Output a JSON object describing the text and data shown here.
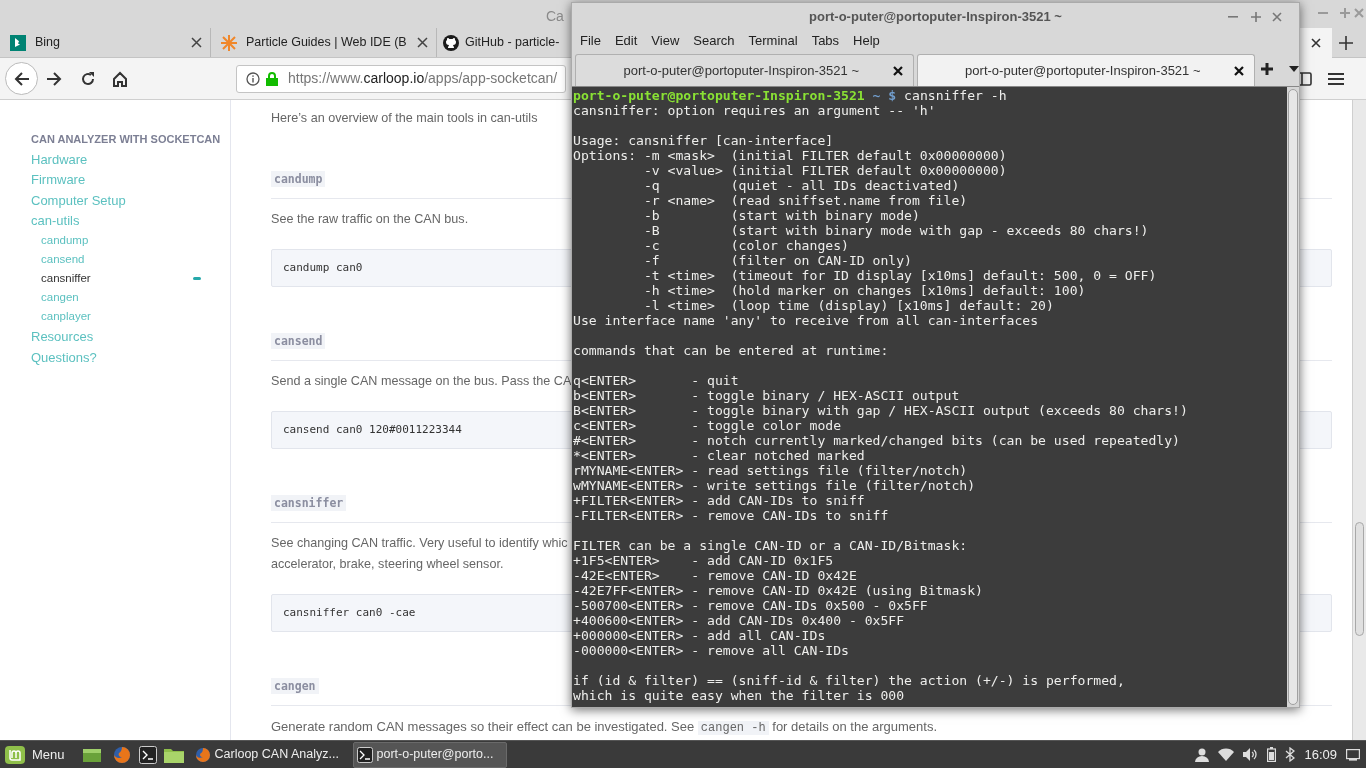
{
  "browser": {
    "title": "Ca",
    "tabs": [
      {
        "title": "Bing",
        "selected": false
      },
      {
        "title": "Particle Guides | Web IDE (B",
        "selected": false
      },
      {
        "title": "GitHub - particle-",
        "selected": false
      }
    ],
    "url": {
      "prefix": "https://www.",
      "domain": "carloop.io",
      "path": "/apps/app-socketcan/"
    },
    "sidebar": {
      "heading": "CAN ANALYZER WITH SOCKETCAN",
      "items": [
        {
          "label": "Hardware",
          "selected": false
        },
        {
          "label": "Firmware",
          "selected": false
        },
        {
          "label": "Computer Setup",
          "selected": false
        },
        {
          "label": "can-utils",
          "selected": false,
          "children": [
            {
              "label": "candump",
              "selected": false
            },
            {
              "label": "cansend",
              "selected": false
            },
            {
              "label": "cansniffer",
              "selected": true
            },
            {
              "label": "cangen",
              "selected": false
            },
            {
              "label": "canplayer",
              "selected": false
            }
          ]
        },
        {
          "label": "Resources",
          "selected": false
        },
        {
          "label": "Questions?",
          "selected": false
        }
      ]
    },
    "content": [
      {
        "kind": "paragraph",
        "lines": [
          "Here’s an overview of the main tools in can-utils"
        ]
      },
      {
        "kind": "heading",
        "text": "candump"
      },
      {
        "kind": "paragraph",
        "lines": [
          "See the raw traffic on the CAN bus."
        ]
      },
      {
        "kind": "code",
        "text": "candump can0"
      },
      {
        "kind": "heading",
        "text": "cansend"
      },
      {
        "kind": "paragraph",
        "lines": [
          "Send a single CAN message on the bus. Pass the CA"
        ]
      },
      {
        "kind": "code",
        "text": "cansend can0 120#0011223344"
      },
      {
        "kind": "heading",
        "text": "cansniffer"
      },
      {
        "kind": "paragraph",
        "lines": [
          "See changing CAN traffic. Very useful to identify whic",
          "accelerator, brake, steering wheel sensor."
        ]
      },
      {
        "kind": "code",
        "text": "cansniffer can0 -cae"
      },
      {
        "kind": "heading",
        "text": "cangen"
      },
      {
        "kind": "mixed",
        "before": "Generate random CAN messages so their effect can be investigated. See ",
        "code": "cangen -h",
        "after": " for details on the arguments."
      }
    ]
  },
  "terminal": {
    "title": "port-o-puter@portoputer-Inspiron-3521 ~",
    "menu": [
      "File",
      "Edit",
      "View",
      "Search",
      "Terminal",
      "Tabs",
      "Help"
    ],
    "tabs": [
      {
        "title": "port-o-puter@portoputer-Inspiron-3521 ~",
        "selected": false
      },
      {
        "title": "port-o-puter@portoputer-Inspiron-3521 ~",
        "selected": true
      }
    ],
    "prompt": {
      "user_host": "port-o-puter@portoputer-Inspiron-3521",
      "path": "~",
      "symbol": "$",
      "command": "cansniffer -h"
    },
    "output": [
      [
        "cansniffer: option requires an argument -- 'h'"
      ],
      [
        "Usage: cansniffer [can-interface]",
        "Options: -m <mask>  (initial FILTER default 0x00000000)",
        "         -v <value> (initial FILTER default 0x00000000)",
        "         -q         (quiet - all IDs deactivated)",
        "         -r <name>  (read sniffset.name from file)",
        "         -b         (start with binary mode)",
        "         -B         (start with binary mode with gap - exceeds 80 chars!)",
        "         -c         (color changes)",
        "         -f         (filter on CAN-ID only)",
        "         -t <time>  (timeout for ID display [x10ms] default: 500, 0 = OFF)",
        "         -h <time>  (hold marker on changes [x10ms] default: 100)",
        "         -l <time>  (loop time (display) [x10ms] default: 20)",
        "Use interface name 'any' to receive from all can-interfaces"
      ],
      [
        "commands that can be entered at runtime:"
      ],
      [
        "q<ENTER>       - quit",
        "b<ENTER>       - toggle binary / HEX-ASCII output",
        "B<ENTER>       - toggle binary with gap / HEX-ASCII output (exceeds 80 chars!)",
        "c<ENTER>       - toggle color mode",
        "#<ENTER>       - notch currently marked/changed bits (can be used repeatedly)",
        "*<ENTER>       - clear notched marked",
        "rMYNAME<ENTER> - read settings file (filter/notch)",
        "wMYNAME<ENTER> - write settings file (filter/notch)",
        "+FILTER<ENTER> - add CAN-IDs to sniff",
        "-FILTER<ENTER> - remove CAN-IDs to sniff"
      ],
      [
        "FILTER can be a single CAN-ID or a CAN-ID/Bitmask:",
        "+1F5<ENTER>    - add CAN-ID 0x1F5",
        "-42E<ENTER>    - remove CAN-ID 0x42E",
        "-42E7FF<ENTER> - remove CAN-ID 0x42E (using Bitmask)",
        "-500700<ENTER> - remove CAN-IDs 0x500 - 0x5FF",
        "+400600<ENTER> - add CAN-IDs 0x400 - 0x5FF",
        "+000000<ENTER> - add all CAN-IDs",
        "-000000<ENTER> - remove all CAN-IDs"
      ],
      [
        "if (id & filter) == (sniff-id & filter) the action (+/-) is performed,",
        "which is quite easy when the filter is 000"
      ]
    ]
  },
  "taskbar": {
    "menu_label": "Menu",
    "tasks": [
      {
        "label": "Carloop CAN Analyz...",
        "selected": false
      },
      {
        "label": "port-o-puter@porto...",
        "selected": true
      }
    ],
    "clock": "16:09"
  }
}
